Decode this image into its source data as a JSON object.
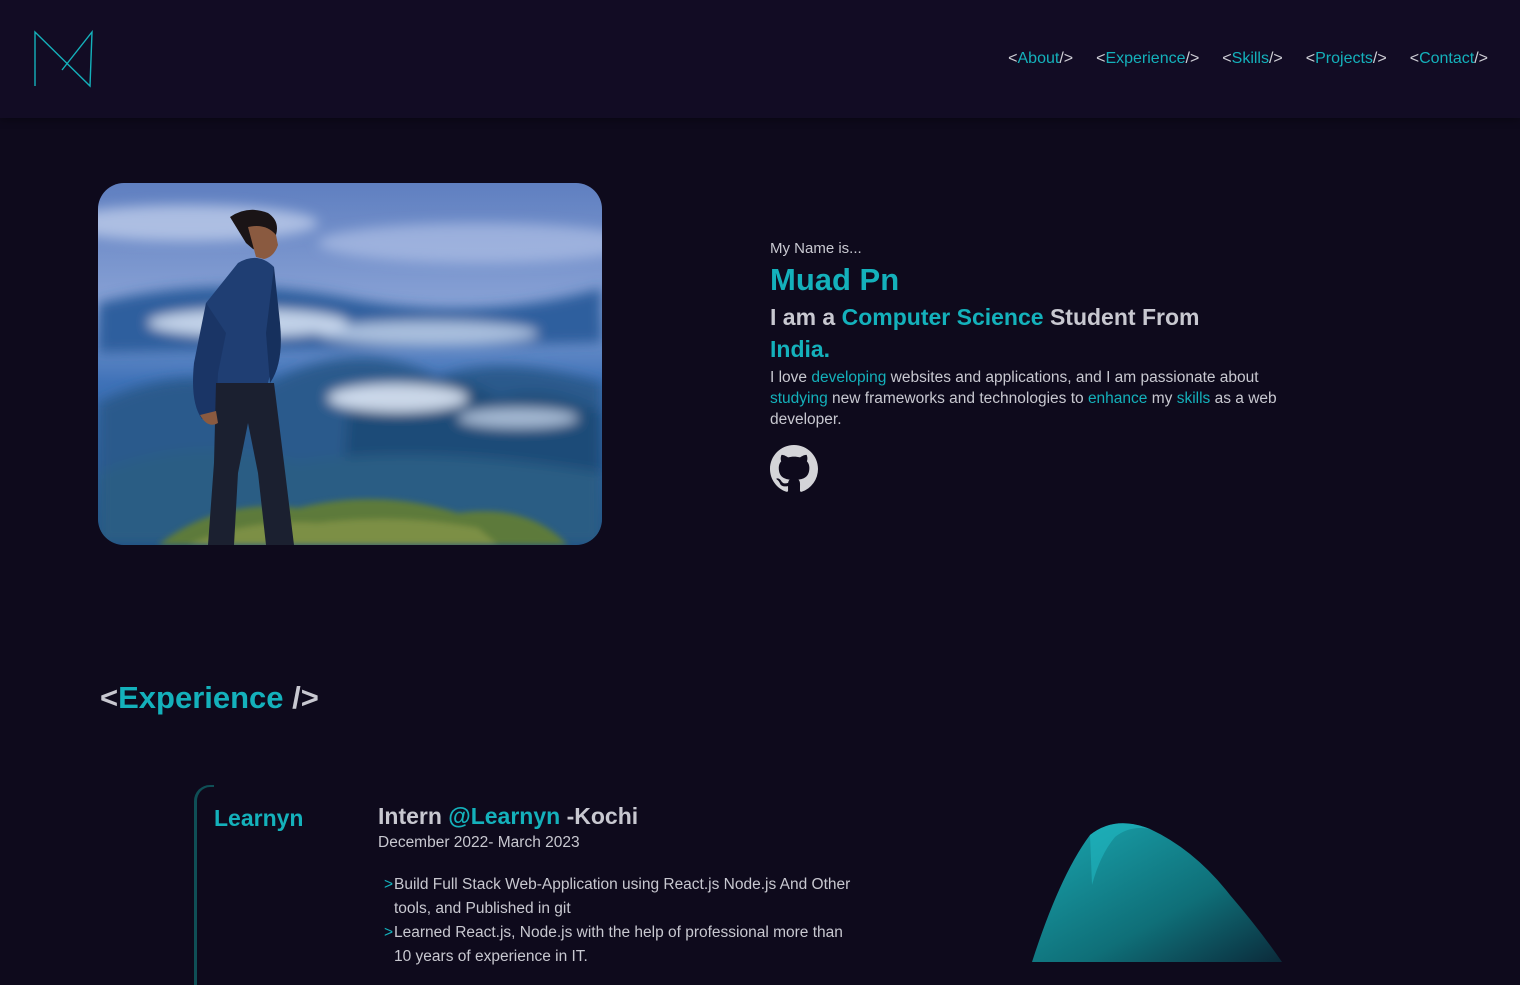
{
  "nav": {
    "items": [
      {
        "open": "<",
        "label": "About",
        "close": "/>"
      },
      {
        "open": "<",
        "label": "Experience",
        "close": "/>"
      },
      {
        "open": "<",
        "label": "Skills",
        "close": "/>"
      },
      {
        "open": "<",
        "label": "Projects",
        "close": "/>"
      },
      {
        "open": "<",
        "label": "Contact",
        "close": "/>"
      }
    ]
  },
  "intro": {
    "greeting": "My Name is...",
    "name": "Muad Pn",
    "tagline_part1": "I am a ",
    "tagline_accent1": "Computer Science",
    "tagline_part2": " Student From ",
    "tagline_accent2": "India.",
    "bio": [
      {
        "text": "I love ",
        "accent": false
      },
      {
        "text": "developing",
        "accent": true
      },
      {
        "text": " websites and applications, and I am passionate about ",
        "accent": false
      },
      {
        "text": "studying",
        "accent": true
      },
      {
        "text": " new frameworks and technologies to ",
        "accent": false
      },
      {
        "text": "enhance",
        "accent": true
      },
      {
        "text": " my ",
        "accent": false
      },
      {
        "text": "skills",
        "accent": true
      },
      {
        "text": " as a web developer.",
        "accent": false
      }
    ]
  },
  "experience": {
    "title_open": "<",
    "title": "Experience",
    "title_close": " />",
    "company": "Learnyn",
    "role_prefix": "Intern ",
    "role_company": "@Learnyn",
    "role_suffix": " -Kochi",
    "dates": "December 2022- March 2023",
    "bullets": [
      "Build Full Stack Web-Application using React.js Node.js And Other tools, and Published in git",
      "Learned React.js, Node.js with the help of professional more than 10 years of experience in IT."
    ],
    "bullet_mark": ">"
  },
  "colors": {
    "background": "#0e0a1c",
    "header": "#120c24",
    "accent": "#14b1bb",
    "text": "#c8c8d0"
  },
  "icons": [
    "logo-monogram-icon",
    "github-icon"
  ]
}
